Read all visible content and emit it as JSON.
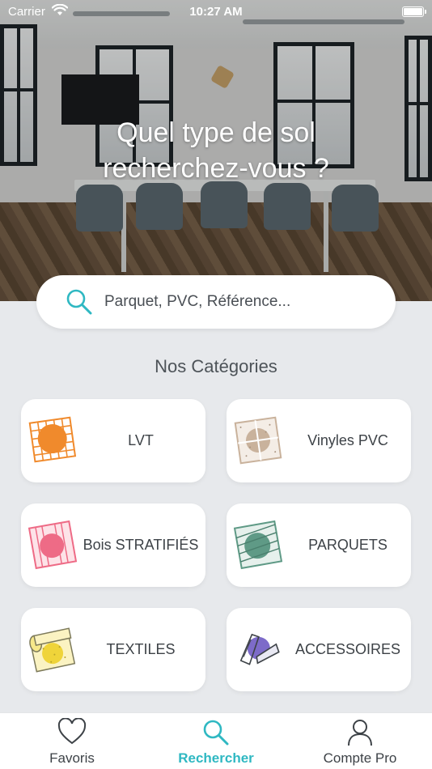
{
  "status_bar": {
    "carrier": "Carrier",
    "time": "10:27 AM"
  },
  "hero": {
    "title_line1": "Quel type de sol",
    "title_line2": "recherchez-vous ?"
  },
  "search": {
    "placeholder": "Parquet, PVC, Référence...",
    "value": ""
  },
  "categories_title": "Nos Catégories",
  "categories": [
    {
      "label": "LVT",
      "icon": "lvt-tile-icon",
      "color": "#f08a2c"
    },
    {
      "label": "Vinyles PVC",
      "icon": "vinyl-tile-icon",
      "color": "#c9b29c"
    },
    {
      "label": "Bois STRATIFIÉS",
      "icon": "laminate-tile-icon",
      "color": "#ee6b86"
    },
    {
      "label": "PARQUETS",
      "icon": "parquet-tile-icon",
      "color": "#5f9a86"
    },
    {
      "label": "TEXTILES",
      "icon": "textile-roll-icon",
      "color": "#efd43a"
    },
    {
      "label": "ACCESSOIRES",
      "icon": "accessories-icon",
      "color": "#7d6bc9"
    }
  ],
  "tabs": [
    {
      "label": "Favoris",
      "icon": "heart-icon",
      "active": false
    },
    {
      "label": "Rechercher",
      "icon": "search-icon",
      "active": true
    },
    {
      "label": "Compte Pro",
      "icon": "user-icon",
      "active": false
    }
  ],
  "colors": {
    "accent": "#2fb8c2",
    "background": "#e7e9ec",
    "text": "#3d4247"
  }
}
